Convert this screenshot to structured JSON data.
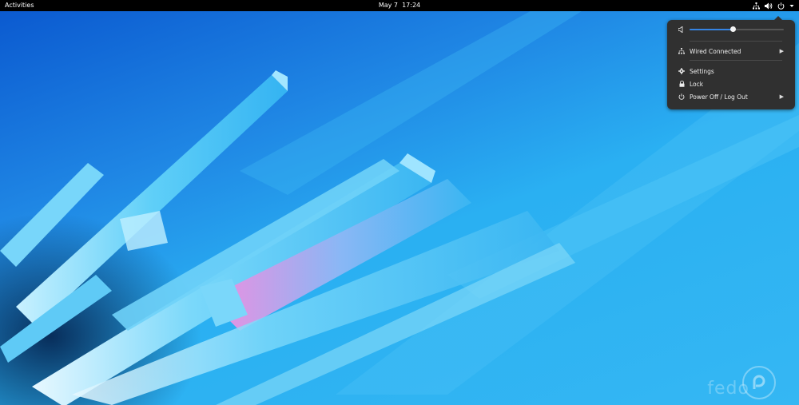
{
  "topbar": {
    "activities": "Activities",
    "date": "May 7",
    "time": "17:24",
    "tray_icons": [
      "network-icon",
      "volume-icon",
      "power-icon",
      "chevron-down-icon"
    ]
  },
  "menu": {
    "volume": {
      "icon": "volume-low-icon",
      "level": 0.46
    },
    "network": {
      "label": "Wired Connected",
      "icon": "network-icon"
    },
    "settings": {
      "label": "Settings",
      "icon": "gear-icon"
    },
    "lock": {
      "label": "Lock",
      "icon": "lock-icon"
    },
    "power": {
      "label": "Power Off / Log Out",
      "icon": "power-icon"
    }
  },
  "watermark": {
    "text": "fedo"
  },
  "colors": {
    "accent": "#3584e4",
    "menu_bg": "#303030",
    "topbar_bg": "#000000"
  }
}
